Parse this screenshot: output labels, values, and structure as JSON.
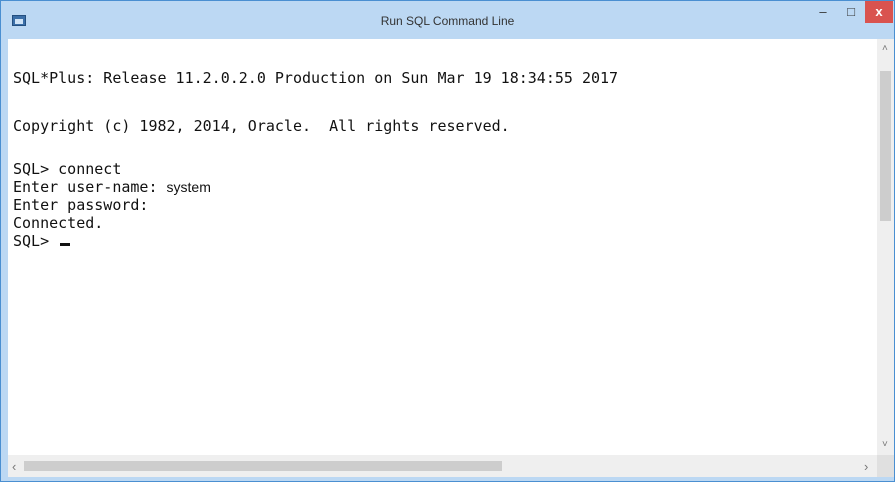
{
  "window": {
    "title": "Run SQL Command Line",
    "minimize_glyph": "‒",
    "maximize_glyph": "□",
    "close_glyph": "x",
    "icon": "console-window-icon"
  },
  "console": {
    "banner": "SQL*Plus: Release 11.2.0.2.0 Production on Sun Mar 19 18:34:55 2017",
    "copyright": "Copyright (c) 1982, 2014, Oracle.  All rights reserved.",
    "prompt1": "SQL> connect",
    "user_label": "Enter user-name: ",
    "user_value": "system",
    "password_label": "Enter password:",
    "status": "Connected.",
    "prompt2": "SQL> "
  },
  "scrollbars": {
    "up_arrow": "˄",
    "down_arrow": "˅",
    "left_arrow": "‹",
    "right_arrow": "›"
  }
}
